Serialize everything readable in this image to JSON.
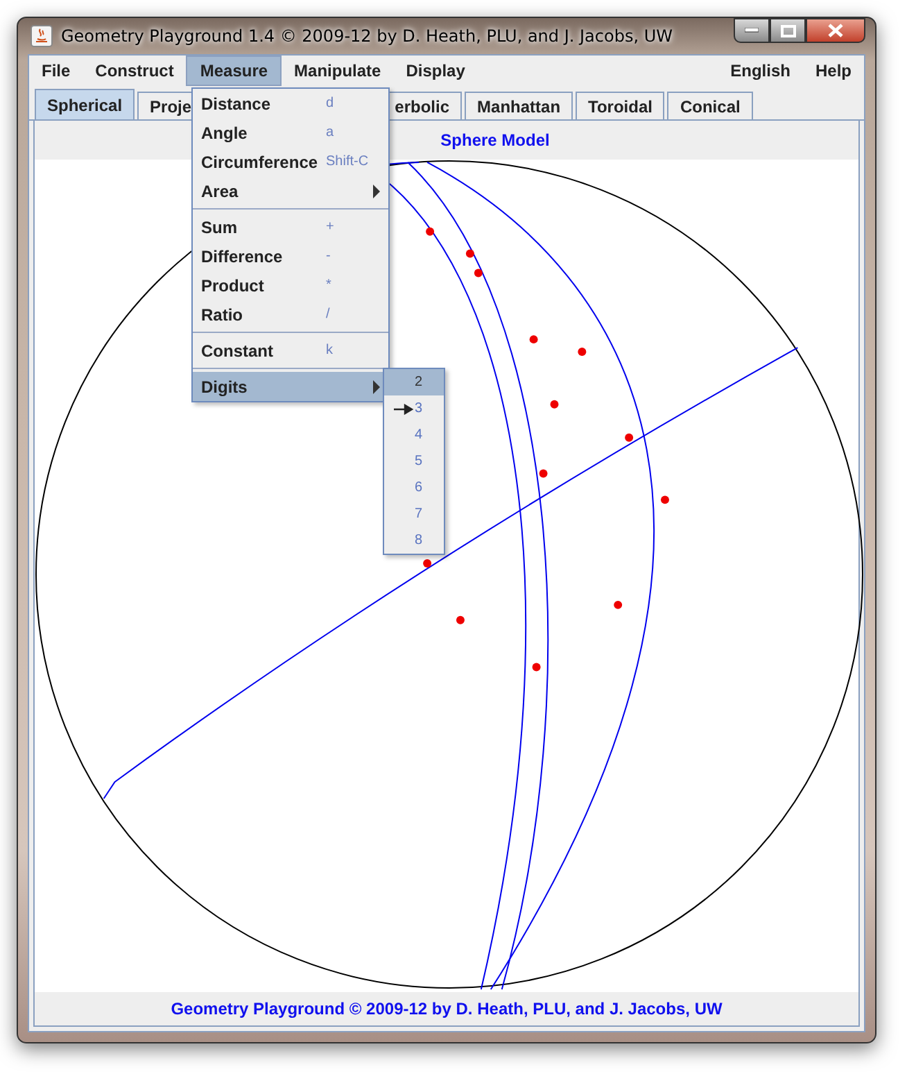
{
  "window": {
    "title": "Geometry Playground 1.4 © 2009-12 by D. Heath, PLU, and J. Jacobs, UW"
  },
  "menubar": {
    "left": [
      {
        "label": "File",
        "selected": false
      },
      {
        "label": "Construct",
        "selected": false
      },
      {
        "label": "Measure",
        "selected": true
      },
      {
        "label": "Manipulate",
        "selected": false
      },
      {
        "label": "Display",
        "selected": false
      }
    ],
    "right": [
      {
        "label": "English",
        "selected": false
      },
      {
        "label": "Help",
        "selected": false
      }
    ]
  },
  "tabs": [
    {
      "label": "Spherical",
      "selected": true
    },
    {
      "label": "Proje",
      "selected": false
    },
    {
      "label": "erbolic",
      "selected": false
    },
    {
      "label": "Manhattan",
      "selected": false
    },
    {
      "label": "Toroidal",
      "selected": false
    },
    {
      "label": "Conical",
      "selected": false
    }
  ],
  "panel_title": "Sphere Model",
  "measure_menu": [
    {
      "kind": "item",
      "label": "Distance",
      "shortcut": "d",
      "selected": false
    },
    {
      "kind": "item",
      "label": "Angle",
      "shortcut": "a",
      "selected": false
    },
    {
      "kind": "item",
      "label": "Circumference",
      "shortcut": "Shift-C",
      "selected": false
    },
    {
      "kind": "submenu",
      "label": "Area",
      "selected": false
    },
    {
      "kind": "separator"
    },
    {
      "kind": "item",
      "label": "Sum",
      "shortcut": "+",
      "selected": false
    },
    {
      "kind": "item",
      "label": "Difference",
      "shortcut": "-",
      "selected": false
    },
    {
      "kind": "item",
      "label": "Product",
      "shortcut": "*",
      "selected": false
    },
    {
      "kind": "item",
      "label": "Ratio",
      "shortcut": "/",
      "selected": false
    },
    {
      "kind": "separator"
    },
    {
      "kind": "item",
      "label": "Constant",
      "shortcut": "k",
      "selected": false
    },
    {
      "kind": "separator"
    },
    {
      "kind": "submenu",
      "label": "Digits",
      "selected": true
    }
  ],
  "digits_menu": [
    {
      "label": "2",
      "selected": true,
      "checked": false
    },
    {
      "label": "3",
      "selected": false,
      "checked": true
    },
    {
      "label": "4",
      "selected": false,
      "checked": false
    },
    {
      "label": "5",
      "selected": false,
      "checked": false
    },
    {
      "label": "6",
      "selected": false,
      "checked": false
    },
    {
      "label": "7",
      "selected": false,
      "checked": false
    },
    {
      "label": "8",
      "selected": false,
      "checked": false
    }
  ],
  "footer": "Geometry Playground © 2009-12 by D. Heath, PLU, and J. Jacobs, UW"
}
